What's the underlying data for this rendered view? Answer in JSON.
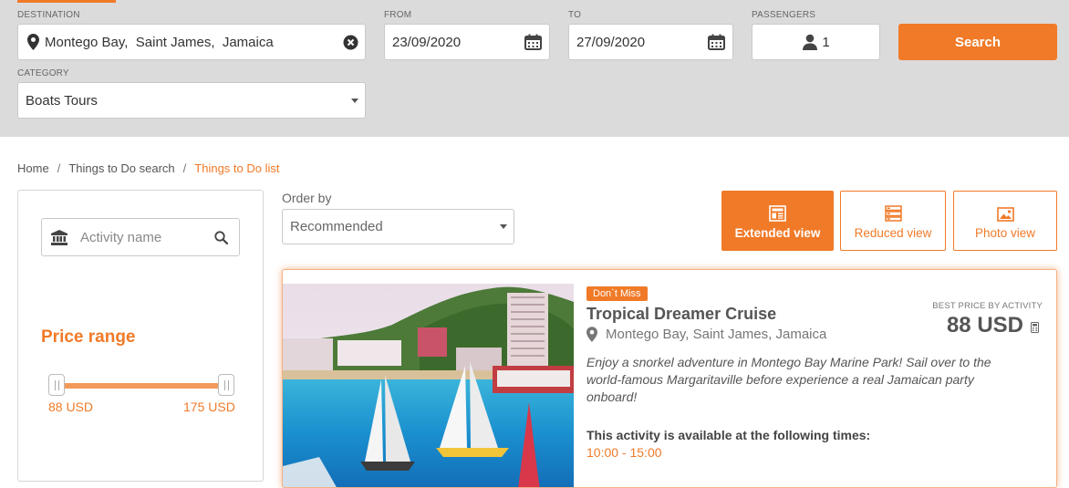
{
  "search": {
    "destination_label": "DESTINATION",
    "destination_value": "Montego Bay,  Saint James,  Jamaica",
    "from_label": "FROM",
    "from_value": "23/09/2020",
    "to_label": "TO",
    "to_value": "27/09/2020",
    "passengers_label": "PASSENGERS",
    "passengers_value": "1",
    "search_button": "Search",
    "category_label": "CATEGORY",
    "category_value": "Boats Tours"
  },
  "breadcrumb": {
    "items": [
      "Home",
      "Things to Do search",
      "Things to Do list"
    ],
    "separator": "/"
  },
  "filters": {
    "activity_placeholder": "Activity name",
    "price_title": "Price range",
    "price_min": "88 USD",
    "price_max": "175 USD"
  },
  "sort": {
    "label": "Order by",
    "value": "Recommended"
  },
  "views": {
    "extended": "Extended view",
    "reduced": "Reduced view",
    "photo": "Photo view",
    "active": "extended"
  },
  "result": {
    "badge": "Don`t Miss",
    "title": "Tropical Dreamer Cruise",
    "location": "Montego Bay, Saint James, Jamaica",
    "description": "Enjoy a snorkel adventure in Montego Bay Marine Park! Sail over to the world-famous Margaritaville before experience a real Jamaican party onboard!",
    "availability_label": "This activity is available at the following times:",
    "times": "10:00 - 15:00",
    "best_price_label": "BEST PRICE BY ACTIVITY",
    "price": "88 USD"
  },
  "colors": {
    "accent": "#f07a28",
    "header_bg": "#dcdbdb"
  }
}
